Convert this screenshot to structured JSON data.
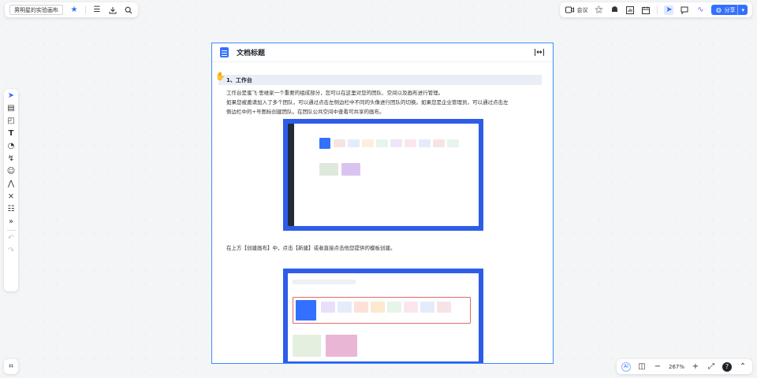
{
  "app": {
    "board_title": "男明星的实验画布",
    "meeting_label": "会议",
    "share_label": "分享",
    "zoom": "267%"
  },
  "document": {
    "title": "文档标题",
    "section_heading": "1、工作台",
    "paragraph1_line1": "工作台是蜜飞·思维家一个重要的组成部分，您可以在这里对您的团队、空间以及画布进行管理。",
    "paragraph1_line2": "如果您被邀请加入了多个团队，可以通过点击左侧边栏中不同的头像进行团队的切换。如果您是企业管理员，可以通过点击左",
    "paragraph1_line3": "侧边栏中的+号图标创建团队。在团队公共空间中查看可共享的画布。",
    "paragraph2": "在上方【创建画布】中，点击【新建】或者直接点击他您提供的模板创建。"
  },
  "icons": {
    "top_left": [
      "star-icon",
      "menu-icon",
      "download-icon",
      "search-icon"
    ],
    "top_right": [
      "video-icon",
      "magic-wand-icon",
      "robot-icon",
      "chart-icon",
      "calendar-icon",
      "pointer-icon",
      "comment-icon",
      "broadcast-icon",
      "globe-icon"
    ],
    "left_toolbar": [
      "select-icon",
      "frame-icon",
      "sticky-note-icon",
      "text-icon",
      "shape-icon",
      "connector-icon",
      "sticker-icon",
      "pen-icon",
      "mindmap-icon",
      "document-icon",
      "more-icon",
      "undo-icon",
      "redo-icon"
    ]
  },
  "colors": {
    "accent": "#3370ff",
    "doc_border": "#3d8bff",
    "screenshot_frame": "#2d5de8"
  }
}
